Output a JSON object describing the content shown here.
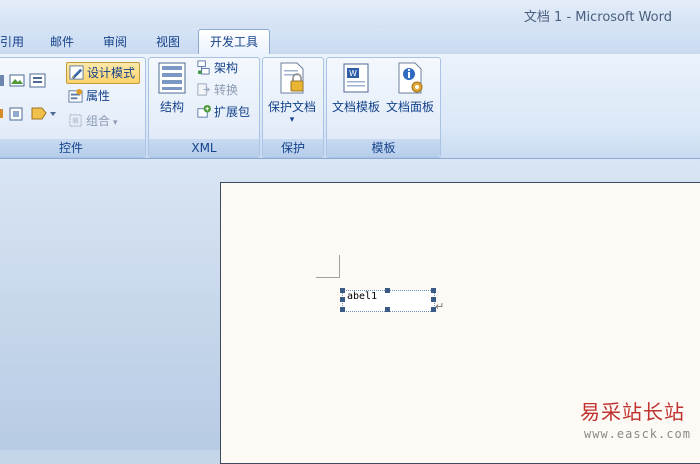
{
  "window": {
    "title": "文档 1 - Microsoft Word"
  },
  "tabs": [
    {
      "label": "引用"
    },
    {
      "label": "邮件"
    },
    {
      "label": "审阅"
    },
    {
      "label": "视图"
    },
    {
      "label": "开发工具",
      "active": true
    }
  ],
  "ribbon": {
    "controls": {
      "label": "控件",
      "design_mode": "设计模式",
      "properties": "属性",
      "group": "组合"
    },
    "xml": {
      "label": "XML",
      "structure": "结构",
      "schema": "架构",
      "transform": "转换",
      "expansion_pack": "扩展包"
    },
    "protect": {
      "label": "保护",
      "protect_document": "保护文档"
    },
    "templates": {
      "label": "模板",
      "document_template": "文档模板",
      "document_panel": "文档面板"
    }
  },
  "document": {
    "control_text": "abel1",
    "paragraph_mark": "↵"
  },
  "watermark": {
    "logo_text": "易采站长站",
    "url": "www.easck.com"
  },
  "colors": {
    "accent": "#15428b",
    "design_mode_highlight": "#fbd36b",
    "watermark_red": "#c0322e"
  }
}
